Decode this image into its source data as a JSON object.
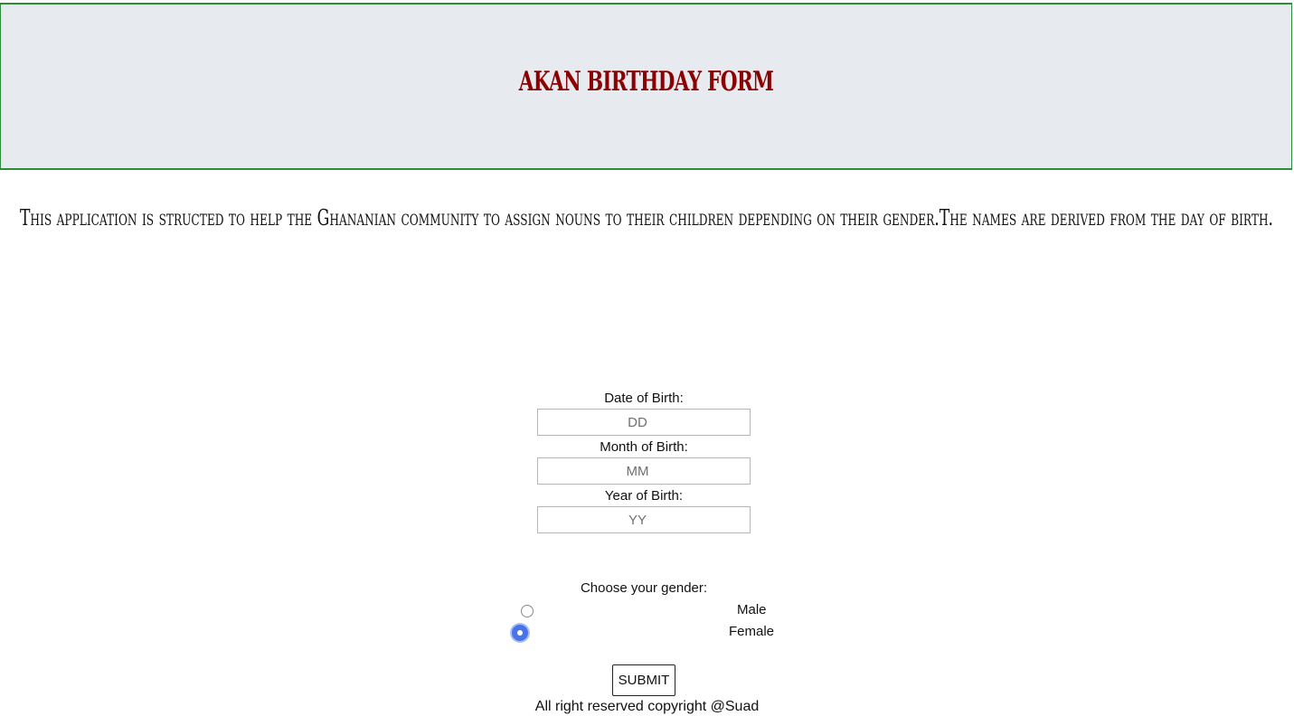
{
  "header": {
    "title": "AKAN BIRTHDAY FORM"
  },
  "intro": {
    "text": "This application is structed to help the Ghananian community to assign nouns to their children depending on their gender.The names are derived from the day of birth."
  },
  "form": {
    "day": {
      "label": "Date of Birth:",
      "placeholder": "DD",
      "value": ""
    },
    "month": {
      "label": "Month of Birth:",
      "placeholder": "MM",
      "value": ""
    },
    "year": {
      "label": "Year of Birth:",
      "placeholder": "YY",
      "value": ""
    },
    "gender": {
      "label": "Choose your gender:",
      "options": [
        {
          "label": "Male",
          "selected": false
        },
        {
          "label": "Female",
          "selected": true
        }
      ]
    },
    "submit_label": "SUBMIT"
  },
  "footer": {
    "text": "All right reserved copyright @Suad"
  },
  "colors": {
    "header_bg": "#e7eaee",
    "header_border": "#2e8b3a",
    "title": "#8b0000",
    "radio_selected": "#4a73e8"
  }
}
